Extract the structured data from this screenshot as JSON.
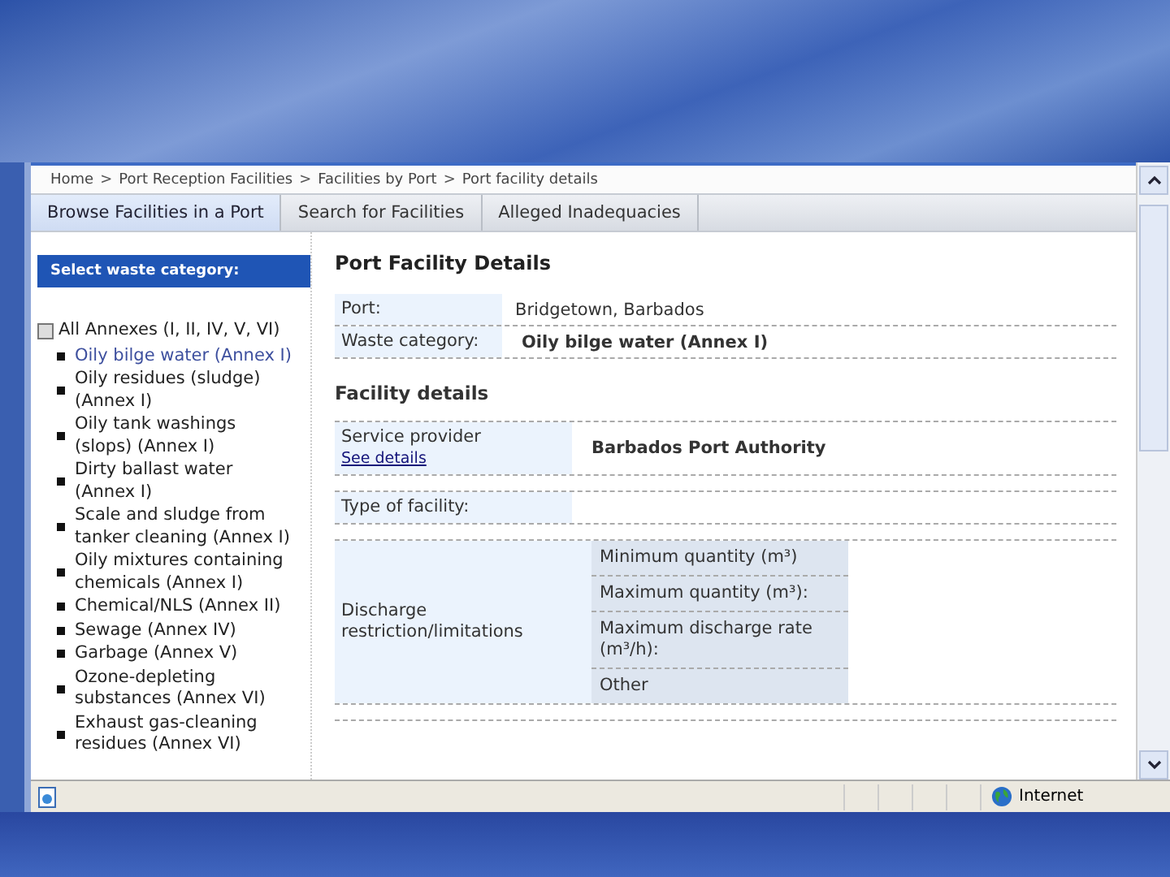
{
  "breadcrumb": [
    "Home",
    "Port Reception Facilities",
    "Facilities by Port",
    "Port facility details"
  ],
  "breadcrumb_separator": ">",
  "tabs": [
    {
      "label": "Browse Facilities in a Port",
      "selected": true
    },
    {
      "label": "Search for Facilities",
      "selected": false
    },
    {
      "label": "Alleged Inadequacies",
      "selected": false
    }
  ],
  "sidebar": {
    "heading": "Select waste category:",
    "tree": [
      {
        "label": "All Annexes (I, II, IV, V, VI)",
        "expanded": true,
        "selected": false,
        "children": [
          {
            "label": "Oily bilge water (Annex I)",
            "selected": true
          },
          {
            "label": "Oily residues (sludge) (Annex I)",
            "selected": false
          },
          {
            "label": "Oily tank washings (slops) (Annex I)",
            "selected": false
          },
          {
            "label": "Dirty ballast water (Annex I)",
            "selected": false
          },
          {
            "label": "Scale and sludge from tanker cleaning (Annex I)",
            "selected": false
          },
          {
            "label": "Oily mixtures containing chemicals (Annex I)",
            "selected": false
          },
          {
            "label": "Chemical/NLS (Annex II)",
            "selected": false
          },
          {
            "label": "Sewage (Annex IV)",
            "selected": false
          },
          {
            "label": "Garbage (Annex V)",
            "selected": false
          },
          {
            "label": "Ozone-depleting substances (Annex VI)",
            "selected": false
          },
          {
            "label": "Exhaust gas-cleaning residues (Annex VI)",
            "selected": false
          }
        ]
      }
    ]
  },
  "details": {
    "title": "Port Facility Details",
    "rows": [
      {
        "label": "Port:",
        "value": "Bridgetown, Barbados",
        "bold": false
      },
      {
        "label": "Waste category:",
        "value": "Oily bilge water (Annex I)",
        "bold": true
      }
    ]
  },
  "facility": {
    "title": "Facility details",
    "provider": {
      "label": "Service provider",
      "link": "See details",
      "value": "Barbados Port Authority"
    },
    "type_label": "Type of facility:",
    "discharge": {
      "label": "Discharge restriction/limitations",
      "items": [
        "Minimum quantity (m³)",
        "Maximum quantity (m³):",
        "Maximum discharge rate (m³/h):",
        "Other"
      ]
    }
  },
  "status_bar": {
    "zone": "Internet"
  }
}
